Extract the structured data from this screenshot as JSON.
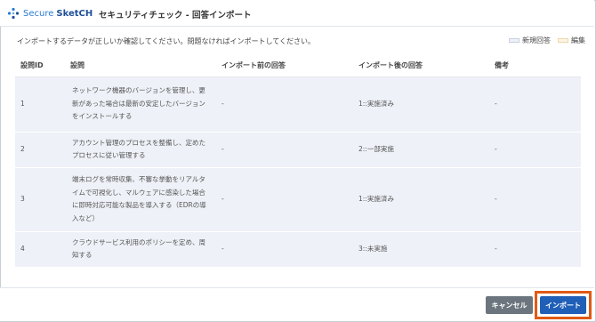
{
  "header": {
    "logo_part1": "Secure",
    "logo_part2": "SketCH",
    "title": "セキュリティチェック - 回答インポート"
  },
  "instruction": "インポートするデータが正しいか確認してください。問題なければインポートしてください。",
  "legend": {
    "new_label": "新規回答",
    "edit_label": "編集"
  },
  "table": {
    "columns": [
      "設問ID",
      "設問",
      "インポート前の回答",
      "インポート後の回答",
      "備考"
    ],
    "rows": [
      {
        "id": "1",
        "question": "ネットワーク機器のバージョンを管理し、更新があった場合は最新の安定したバージョンをインストールする",
        "before": "-",
        "after": "1::実施済み",
        "note": "-"
      },
      {
        "id": "2",
        "question": "アカウント管理のプロセスを整備し、定めたプロセスに従い管理する",
        "before": "-",
        "after": "2::一部実施",
        "note": "-"
      },
      {
        "id": "3",
        "question": "端末ログを常時収集、不審な挙動をリアルタイムで可視化し、マルウェアに感染した場合に即時対応可能な製品を導入する（EDRの導入など）",
        "before": "-",
        "after": "1::実施済み",
        "note": "-"
      },
      {
        "id": "4",
        "question": "クラウドサービス利用のポリシーを定め、周知する",
        "before": "-",
        "after": "3::未実施",
        "note": "-"
      }
    ]
  },
  "footer": {
    "cancel_label": "キャンセル",
    "import_label": "インポート"
  },
  "colors": {
    "accent": "#1f5fb7",
    "row_new": "#eef1f7",
    "highlight": "#e05a14"
  }
}
